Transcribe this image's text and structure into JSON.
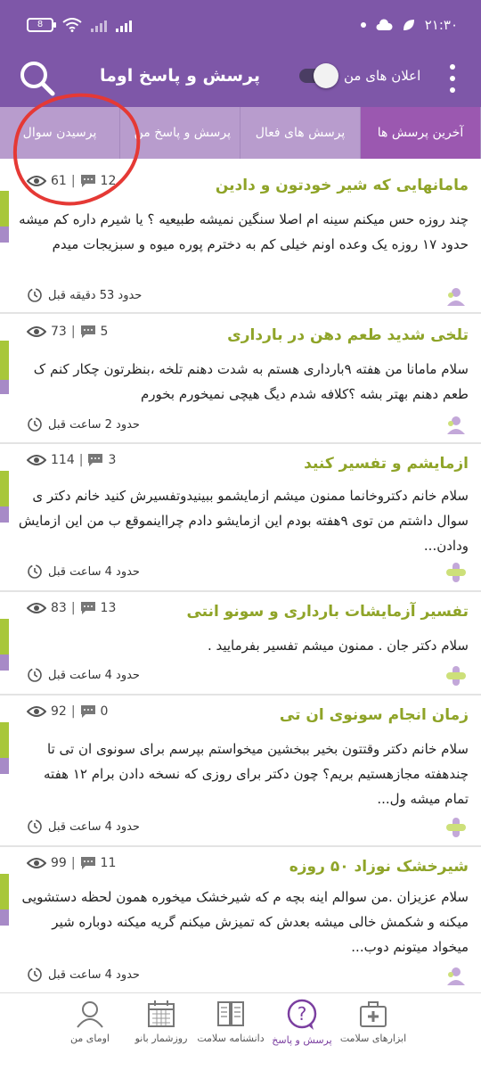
{
  "status_bar": {
    "time": "۲۱:۳۰",
    "battery": "8"
  },
  "app_bar": {
    "title": "پرسش و پاسخ اوما",
    "toggle_label": "اعلان های من"
  },
  "tabs": [
    {
      "label": "پرسیدن سوال"
    },
    {
      "label": "پرسش و پاسخ من"
    },
    {
      "label": "پرسش های فعال"
    },
    {
      "label": "آخرین پرسش ها"
    }
  ],
  "questions": [
    {
      "title": "مامانهایی که شیر خودتون و دادین",
      "views": "61",
      "comments": "12",
      "body": "چند روزه حس میکنم سینه ام اصلا سنگین نمیشه طبیعیه ؟ یا شیرم داره کم میشه  حدود ۱۷ روزه یک وعده اونم خیلی کم به دخترم پوره میوه و سبزیجات میدم",
      "time": "حدود 53 دقیقه قبل"
    },
    {
      "title": "تلخی شدید طعم دهن در بارداری",
      "views": "73",
      "comments": "5",
      "body": "سلام مامانا من هفته ۹بارداری هستم به شدت دهنم تلخه ،بنظرتون چکار کنم ک طعم دهنم بهتر بشه ؟کلافه شدم دیگ هیچی نمیخورم بخورم",
      "time": "حدود 2 ساعت قبل"
    },
    {
      "title": "ازمایشم و تفسیر کنید",
      "views": "114",
      "comments": "3",
      "body": "سلام خانم دکتروخانما ممنون میشم ازمایشمو ببینیدوتفسیرش کنید خانم دکتر ی سوال داشتم من توی ۹هفته بودم این ازمایشو دادم چرااینموقع ب من این ازمایش ودادن...",
      "time": "حدود 4 ساعت قبل"
    },
    {
      "title": "تفسیر آزمایشات بارداری و سونو انتی",
      "views": "83",
      "comments": "13",
      "body": "سلام دکتر جان . ممنون میشم تفسیر بفرمایید .",
      "time": "حدود 4 ساعت قبل"
    },
    {
      "title": "زمان انجام سونوی ان تی",
      "views": "92",
      "comments": "0",
      "body": "سلام خانم دکتر وقتتون بخیر ببخشین میخواستم بپرسم برای سونوی ان تی تا چندهفته مجازهستیم بریم؟ چون دکتر برای روزی که نسخه دادن برام ۱۲ هفته تمام میشه ول...",
      "time": "حدود 4 ساعت قبل"
    },
    {
      "title": "شیرخشک نوزاد ۵۰ روزه",
      "views": "99",
      "comments": "11",
      "body": "سلام عزیزان .من سوالم اینه بچه م که شیرخشک میخوره همون لحظه دستشویی میکنه و شکمش خالی میشه بعدش که تمیزش میکنم گریه میکنه دوباره شیر میخواد میتونم دوب...",
      "time": "حدود 4 ساعت قبل"
    }
  ],
  "bottom_nav": [
    {
      "label": "اومای من",
      "icon": "user-icon"
    },
    {
      "label": "روزشمار بانو",
      "icon": "calendar-icon"
    },
    {
      "label": "دانشنامه سلامت",
      "icon": "book-icon"
    },
    {
      "label": "پرسش و پاسخ",
      "icon": "question-icon",
      "active": true
    },
    {
      "label": "ابزارهای سلامت",
      "icon": "medical-kit-icon"
    }
  ],
  "colors": {
    "primary": "#7e57a8",
    "tab_active": "#9b58b0",
    "tab_inactive": "#b89ccd",
    "title_green": "#8fa428",
    "annotation_red": "#e53935"
  }
}
